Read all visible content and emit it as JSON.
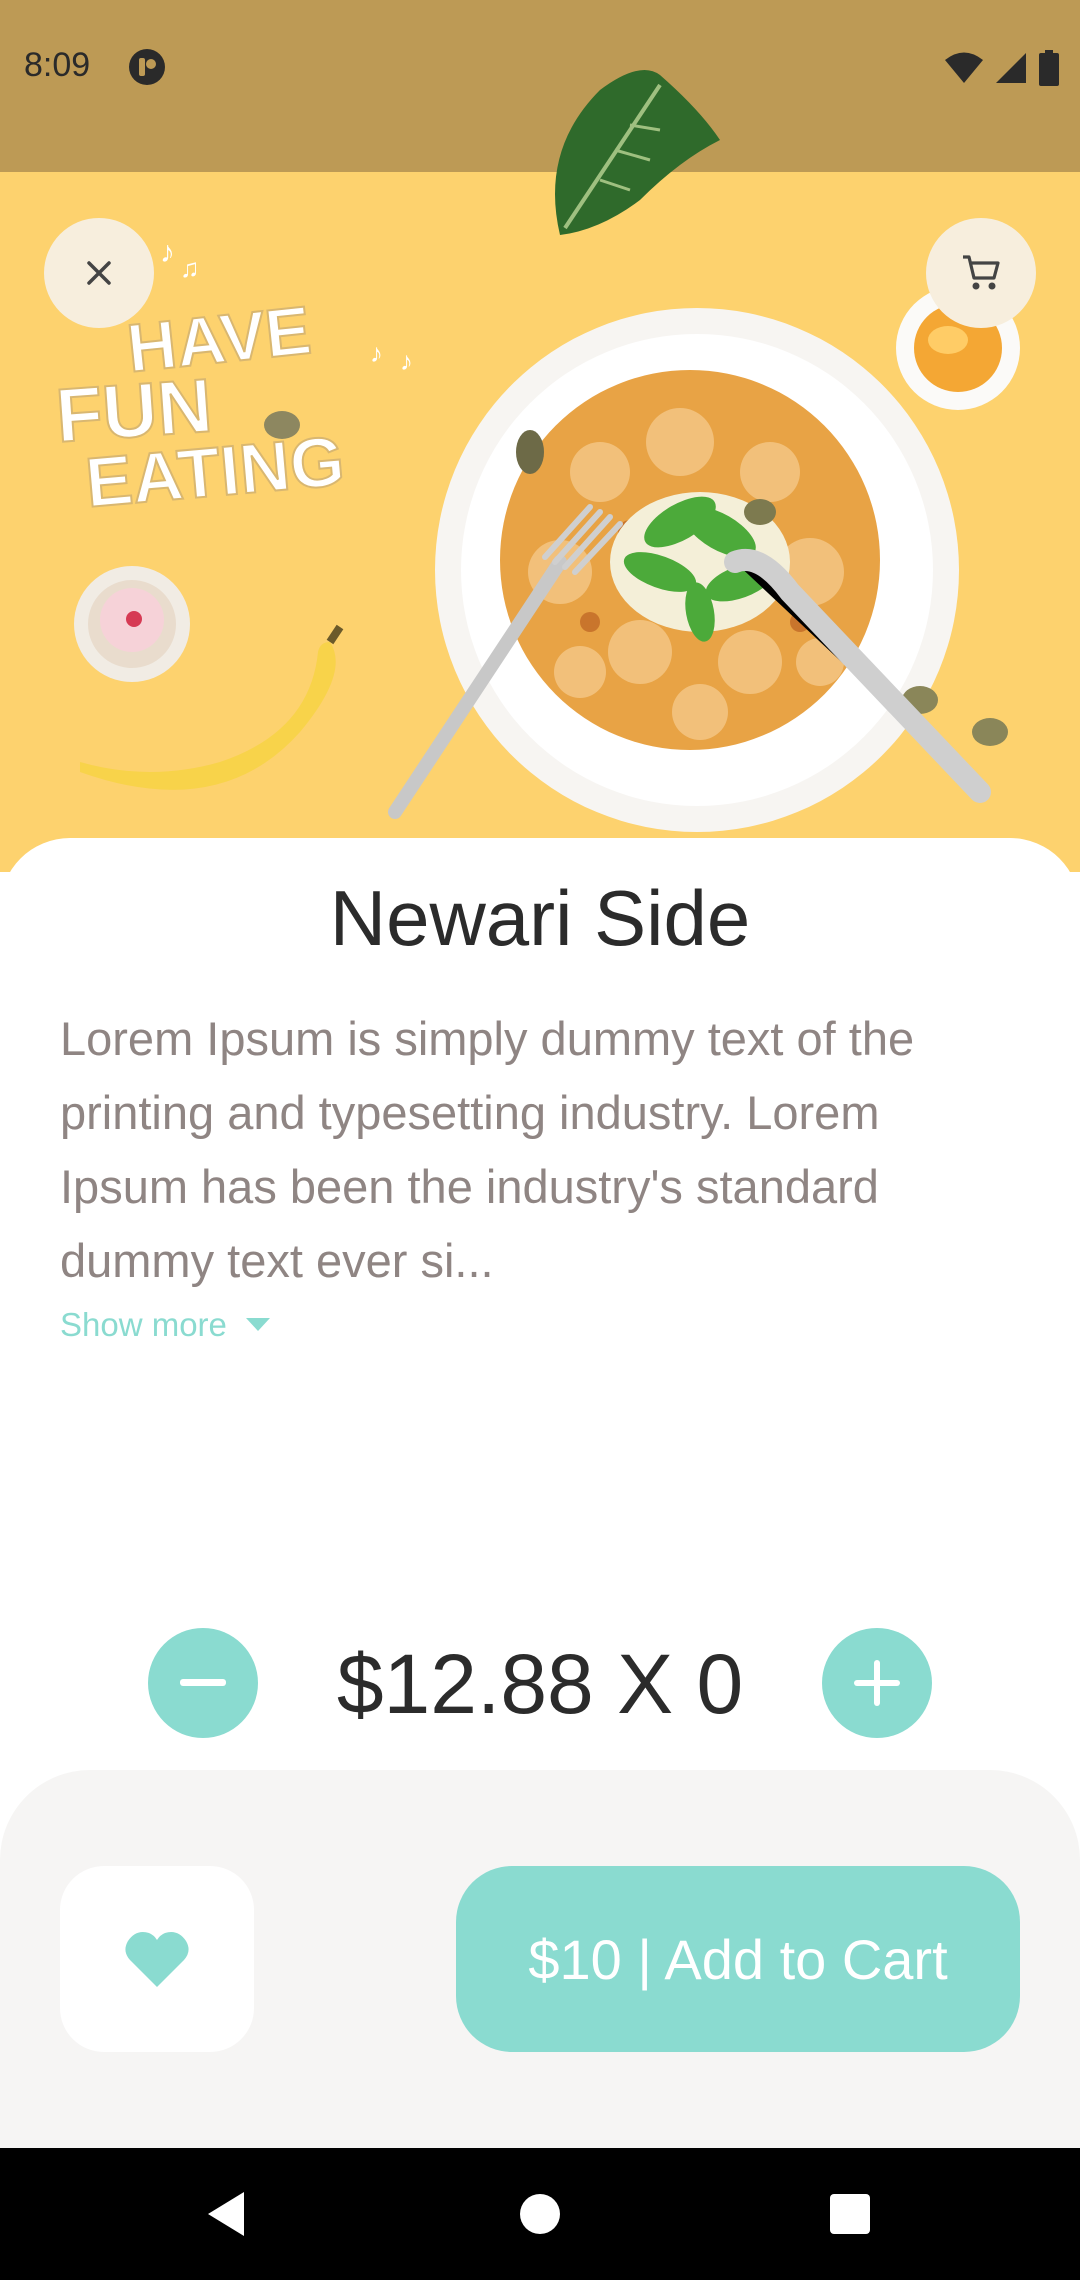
{
  "status_bar": {
    "time": "8:09",
    "icons": [
      "app-notification-icon",
      "wifi-icon",
      "signal-icon",
      "battery-icon"
    ]
  },
  "hero": {
    "banner_text": [
      "HAVE",
      "FUN",
      "EATING"
    ],
    "close_icon": "close-icon",
    "cart_icon": "cart-icon"
  },
  "product": {
    "name": "Newari Side",
    "description": "Lorem Ipsum is simply dummy text of the printing and typesetting industry. Lorem Ipsum has been the industry's standard dummy text ever si...",
    "show_more_label": "Show more",
    "price_qty": "$12.88 X 0"
  },
  "actions": {
    "add_to_cart_label": "$10 | Add to Cart",
    "favorite_icon": "heart-icon"
  },
  "colors": {
    "accent": "#8ADBD0",
    "status_bar_bg": "#BD9A55",
    "hero_bg": "#FDD26E",
    "bottom_bar_bg": "#F6F5F4"
  }
}
